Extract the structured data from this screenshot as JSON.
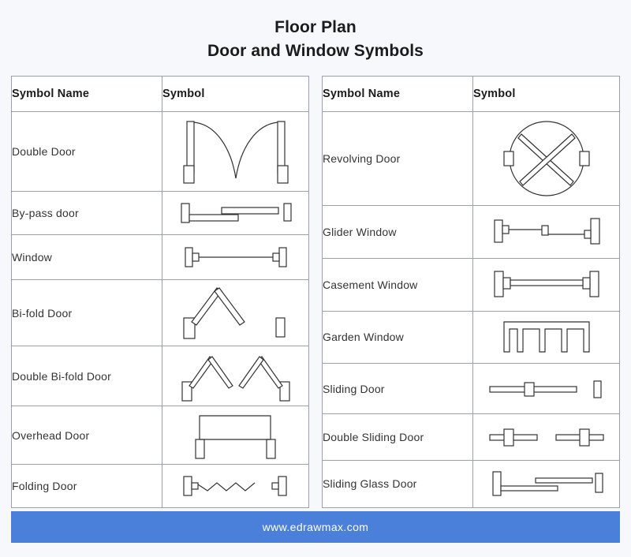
{
  "title": {
    "line1": "Floor Plan",
    "line2": "Door and Window Symbols"
  },
  "colors": {
    "background": "#f7f8fc",
    "table_background": "#ffffff",
    "border": "#9aa0b0",
    "title_text": "#1b1b1b",
    "row_text": "#333333",
    "footer_bar": "#4a80da",
    "footer_text": "#ffffff",
    "symbol_stroke": "#333333"
  },
  "left_table": {
    "headers": {
      "name": "Symbol Name",
      "symbol": "Symbol"
    },
    "rows": [
      {
        "name": "Double Door",
        "symbol": "double-door"
      },
      {
        "name": "By-pass door",
        "symbol": "bypass-door"
      },
      {
        "name": "Window",
        "symbol": "window"
      },
      {
        "name": "Bi-fold Door",
        "symbol": "bi-fold-door"
      },
      {
        "name": "Double Bi-fold Door",
        "symbol": "double-bi-fold-door"
      },
      {
        "name": "Overhead Door",
        "symbol": "overhead-door"
      },
      {
        "name": "Folding Door",
        "symbol": "folding-door"
      }
    ]
  },
  "right_table": {
    "headers": {
      "name": "Symbol Name",
      "symbol": "Symbol"
    },
    "rows": [
      {
        "name": "Revolving Door",
        "symbol": "revolving-door"
      },
      {
        "name": "Glider Window",
        "symbol": "glider-window"
      },
      {
        "name": "Casement Window",
        "symbol": "casement-window"
      },
      {
        "name": "Garden Window",
        "symbol": "garden-window"
      },
      {
        "name": "Sliding Door",
        "symbol": "sliding-door"
      },
      {
        "name": "Double Sliding Door",
        "symbol": "double-sliding-door"
      },
      {
        "name": "Sliding Glass Door",
        "symbol": "sliding-glass-door"
      }
    ]
  },
  "footer": {
    "url": "www.edrawmax.com"
  }
}
